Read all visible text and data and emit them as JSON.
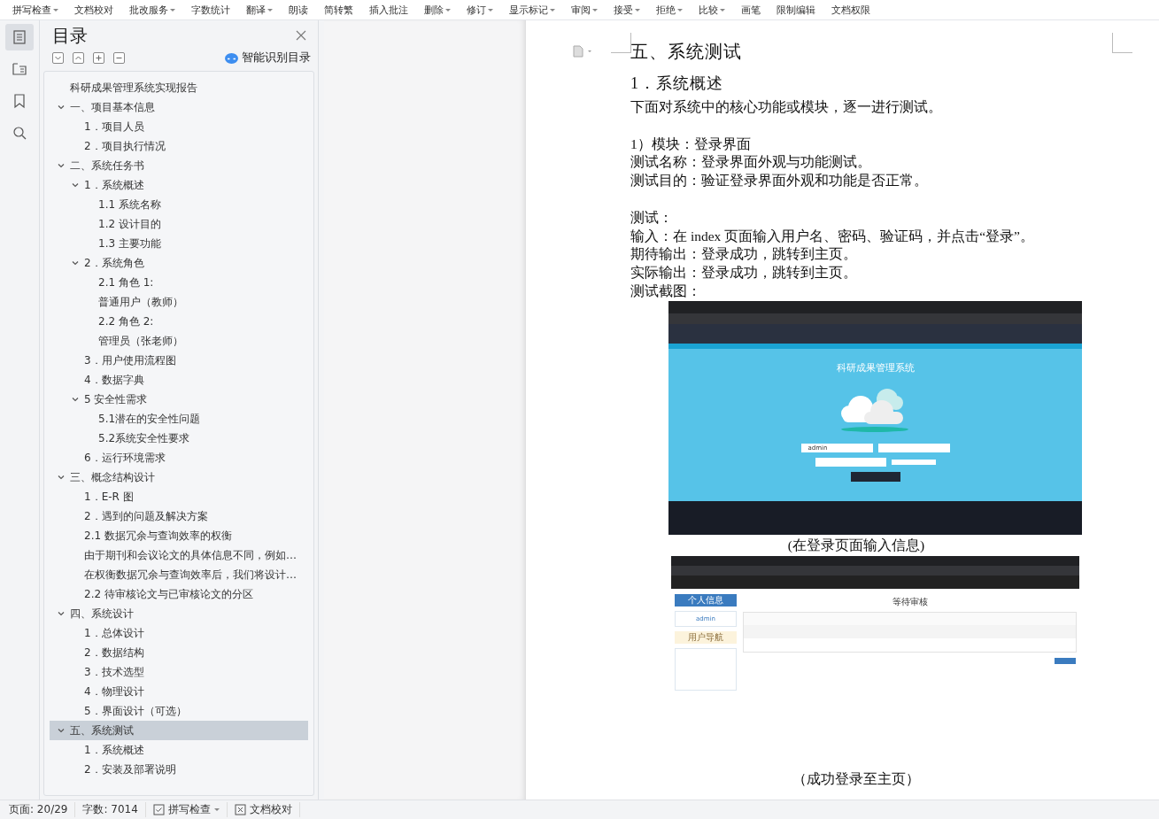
{
  "toolbar": [
    {
      "label": "拼写检查",
      "dropdown": true
    },
    {
      "label": "文档校对",
      "dropdown": false
    },
    {
      "label": "批改服务",
      "dropdown": true
    },
    {
      "label": "字数统计",
      "dropdown": false
    },
    {
      "label": "翻译",
      "dropdown": true
    },
    {
      "label": "朗读",
      "dropdown": false
    },
    {
      "label": "简转繁",
      "dropdown": false
    },
    {
      "label": "插入批注",
      "dropdown": false
    },
    {
      "label": "删除",
      "dropdown": true
    },
    {
      "label": "修订",
      "dropdown": true
    },
    {
      "label": "显示标记",
      "dropdown": true
    },
    {
      "label": "审阅",
      "dropdown": true
    },
    {
      "label": "接受",
      "dropdown": true
    },
    {
      "label": "拒绝",
      "dropdown": true
    },
    {
      "label": "比较",
      "dropdown": true
    },
    {
      "label": "画笔",
      "dropdown": false
    },
    {
      "label": "限制编辑",
      "dropdown": false
    },
    {
      "label": "文档权限",
      "dropdown": false
    }
  ],
  "rail": [
    {
      "kind": "toc",
      "selected": true
    },
    {
      "kind": "nav",
      "selected": false
    },
    {
      "kind": "bookmark",
      "selected": false
    },
    {
      "kind": "search",
      "selected": false
    }
  ],
  "toc": {
    "title": "目录",
    "smart_label": "智能识别目录",
    "items": [
      {
        "label": "科研成果管理系统实现报告",
        "selected": false
      },
      {
        "label": "一、项目基本信息",
        "selected": false,
        "expanded": true,
        "children": [
          {
            "label": "1．项目人员",
            "selected": false
          },
          {
            "label": "2．项目执行情况",
            "selected": false
          }
        ]
      },
      {
        "label": "二、系统任务书",
        "selected": false,
        "expanded": true,
        "children": [
          {
            "label": "1．系统概述",
            "selected": false,
            "expanded": true,
            "children": [
              {
                "label": "1.1  系统名称",
                "selected": false
              },
              {
                "label": "1.2  设计目的",
                "selected": false
              },
              {
                "label": "1.3  主要功能",
                "selected": false
              }
            ]
          },
          {
            "label": "2．系统角色",
            "selected": false,
            "expanded": true,
            "children": [
              {
                "label": "2.1  角色 1:",
                "selected": false
              },
              {
                "label": "普通用户（教师）",
                "selected": false
              },
              {
                "label": "2.2  角色 2:",
                "selected": false
              },
              {
                "label": "管理员（张老师）",
                "selected": false
              }
            ]
          },
          {
            "label": "3．用户使用流程图",
            "selected": false
          },
          {
            "label": "4．数据字典",
            "selected": false
          },
          {
            "label": "5  安全性需求",
            "selected": false,
            "expanded": true,
            "children": [
              {
                "label": "5.1潜在的安全性问题",
                "selected": false
              },
              {
                "label": "5.2系统安全性要求",
                "selected": false
              }
            ]
          },
          {
            "label": "6．运行环境需求",
            "selected": false
          }
        ]
      },
      {
        "label": "三、概念结构设计",
        "selected": false,
        "expanded": true,
        "children": [
          {
            "label": "1．E-R 图",
            "selected": false
          },
          {
            "label": "2．遇到的问题及解决方案",
            "selected": false
          },
          {
            "label": "2.1  数据冗余与查询效率的权衡",
            "selected": false
          },
          {
            "label": "由于期刊和会议论文的具体信息不同，例如…",
            "selected": false
          },
          {
            "label": "在权衡数据冗余与查询效率后，我们将设计…",
            "selected": false
          },
          {
            "label": "2.2  待审核论文与已审核论文的分区",
            "selected": false
          }
        ]
      },
      {
        "label": "四、系统设计",
        "selected": false,
        "expanded": true,
        "children": [
          {
            "label": "1．总体设计",
            "selected": false
          },
          {
            "label": "2．数据结构",
            "selected": false
          },
          {
            "label": "3．技术选型",
            "selected": false
          },
          {
            "label": "4．物理设计",
            "selected": false
          },
          {
            "label": "5．界面设计（可选）",
            "selected": false
          }
        ]
      },
      {
        "label": "五、系统测试",
        "selected": true,
        "expanded": true,
        "children": [
          {
            "label": "1．系统概述",
            "selected": false
          },
          {
            "label": "2．安装及部署说明",
            "selected": false
          }
        ]
      }
    ]
  },
  "document": {
    "blocks": [
      {
        "kind": "h1",
        "text": "五、系统测试"
      },
      {
        "kind": "h2",
        "text": "1．系统概述"
      },
      {
        "kind": "p",
        "text": "下面对系统中的核心功能或模块，逐一进行测试。"
      },
      {
        "kind": "blank"
      },
      {
        "kind": "p",
        "text": "1）模块：登录界面"
      },
      {
        "kind": "p",
        "text": "测试名称：登录界面外观与功能测试。"
      },
      {
        "kind": "p",
        "text": "测试目的：验证登录界面外观和功能是否正常。"
      },
      {
        "kind": "blank"
      },
      {
        "kind": "p",
        "text": "测试："
      },
      {
        "kind": "p",
        "text": "输入：在 index 页面输入用户名、密码、验证码，并点击“登录”。"
      },
      {
        "kind": "p",
        "text": "期待输出：登录成功，跳转到主页。"
      },
      {
        "kind": "p",
        "text": "实际输出：登录成功，跳转到主页。"
      },
      {
        "kind": "p",
        "text": "测试截图："
      },
      {
        "kind": "login_shot",
        "title": "科研成果管理系统",
        "username": "admin"
      },
      {
        "kind": "caption",
        "text": "(在登录页面输入信息)"
      },
      {
        "kind": "home_shot",
        "info_title": "个人信息",
        "username": "admin",
        "nav_title": "用户导航",
        "heading": "等待审核"
      },
      {
        "kind": "caption",
        "text": "（成功登录至主页）"
      }
    ]
  },
  "status_bar": {
    "page": "页面: 20/29",
    "words": "字数: 7014",
    "spell": "拼写检查",
    "proof": "文档校对"
  }
}
